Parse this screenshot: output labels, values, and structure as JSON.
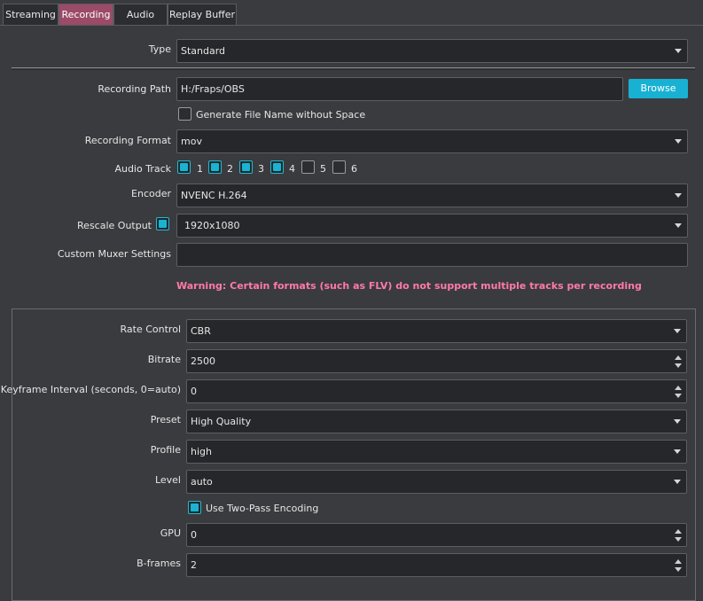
{
  "tabs": [
    {
      "label": "Streaming",
      "active": false
    },
    {
      "label": "Recording",
      "active": true
    },
    {
      "label": "Audio",
      "active": false
    },
    {
      "label": "Replay Buffer",
      "active": false
    }
  ],
  "recording": {
    "type": {
      "label": "Type",
      "value": "Standard"
    },
    "path": {
      "label": "Recording Path",
      "value": "H:/Fraps/OBS",
      "browse_label": "Browse"
    },
    "no_space": {
      "label": "Generate File Name without Space",
      "checked": false
    },
    "format": {
      "label": "Recording Format",
      "value": "mov"
    },
    "audio_track": {
      "label": "Audio Track",
      "tracks": [
        {
          "label": "1",
          "checked": true
        },
        {
          "label": "2",
          "checked": true
        },
        {
          "label": "3",
          "checked": true
        },
        {
          "label": "4",
          "checked": true
        },
        {
          "label": "5",
          "checked": false
        },
        {
          "label": "6",
          "checked": false
        }
      ]
    },
    "encoder": {
      "label": "Encoder",
      "value": "NVENC H.264"
    },
    "rescale": {
      "label": "Rescale Output",
      "checked": true,
      "value": "1920x1080"
    },
    "muxer": {
      "label": "Custom Muxer Settings",
      "value": ""
    },
    "warning": "Warning: Certain formats (such as FLV) do not support multiple tracks per recording"
  },
  "encoder_settings": {
    "rate_control": {
      "label": "Rate Control",
      "value": "CBR"
    },
    "bitrate": {
      "label": "Bitrate",
      "value": "2500"
    },
    "keyframe": {
      "label": "Keyframe Interval (seconds, 0=auto)",
      "value": "0"
    },
    "preset": {
      "label": "Preset",
      "value": "High Quality"
    },
    "profile": {
      "label": "Profile",
      "value": "high"
    },
    "level": {
      "label": "Level",
      "value": "auto"
    },
    "two_pass": {
      "label": "Use Two-Pass Encoding",
      "checked": true
    },
    "gpu": {
      "label": "GPU",
      "value": "0"
    },
    "bframes": {
      "label": "B-frames",
      "value": "2"
    }
  },
  "colors": {
    "accent": "#18b1d4",
    "active_tab": "#9b4a67",
    "warning": "#ff7aa8"
  }
}
